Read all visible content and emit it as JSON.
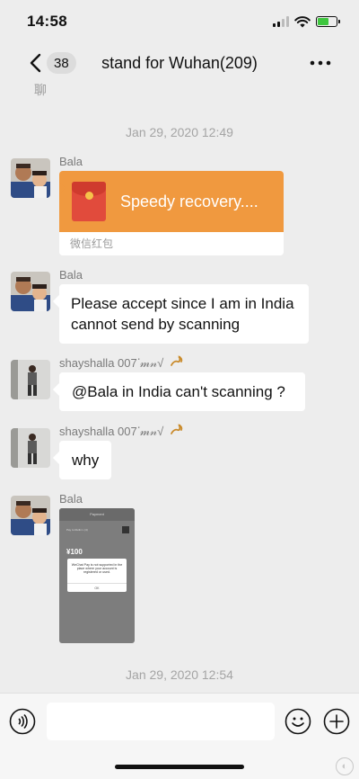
{
  "status_bar": {
    "time": "14:58",
    "battery_charging": true
  },
  "nav": {
    "unread_count": "38",
    "title": "stand for Wuhan(209)"
  },
  "clipped_text": "聊",
  "time_dividers": [
    "Jan 29, 2020 12:49",
    "Jan 29, 2020 12:54"
  ],
  "messages": [
    {
      "sender": "Bala",
      "type": "red_packet",
      "text": "Speedy recovery....",
      "caption": "微信红包"
    },
    {
      "sender": "Bala",
      "type": "text",
      "text": "Please accept since I am in India cannot send by scanning"
    },
    {
      "sender": "shayshalla 007ᐝ𝓂𝓃√",
      "type": "text",
      "text": "@Bala in India can't scanning ?"
    },
    {
      "sender": "shayshalla 007ᐝ𝓂𝓃√",
      "type": "text",
      "text": "why"
    },
    {
      "sender": "Bala",
      "type": "image",
      "image": {
        "header": "Payment",
        "subtitle": "Pay to Ruilin L (4)",
        "amount": "¥100",
        "dialog_text": "WeChat Pay is not supported in the place where your account is registered or used.",
        "dialog_button": "OK"
      }
    }
  ],
  "input_bar": {
    "placeholder": ""
  },
  "icons": [
    "back-chevron-icon",
    "more-dots-icon",
    "voice-icon",
    "emoji-icon",
    "plus-icon",
    "red-packet-icon",
    "scorpion-emoji-icon"
  ],
  "colors": {
    "background": "#ededed",
    "red_packet": "#f0993f",
    "bubble": "#ffffff"
  }
}
